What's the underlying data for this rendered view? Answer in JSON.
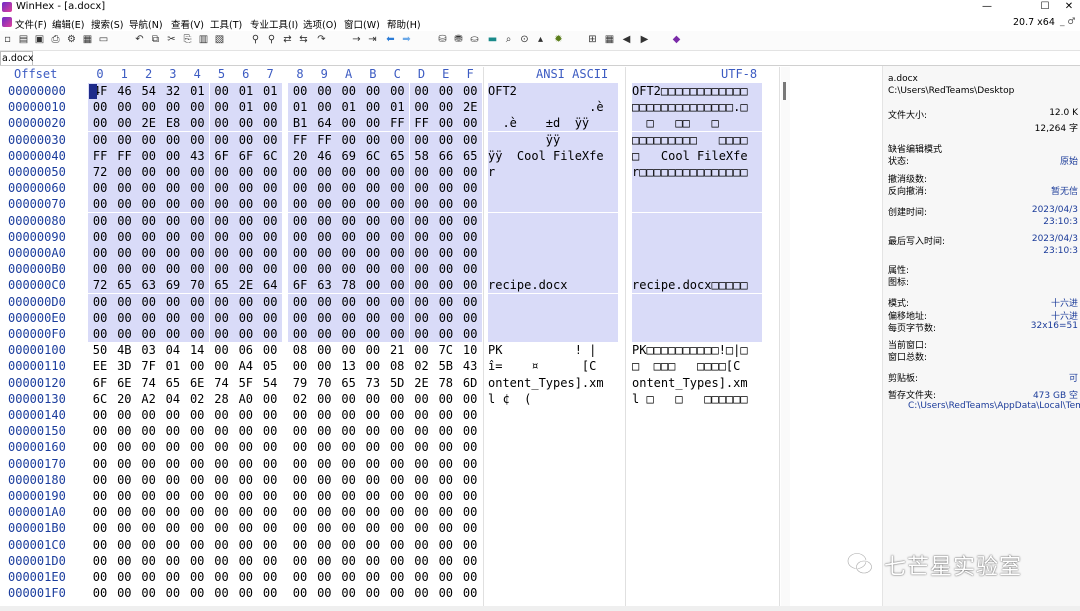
{
  "window": {
    "title": "WinHex - [a.docx]",
    "controls": [
      "—",
      "☐",
      "✕"
    ]
  },
  "menu": {
    "items": [
      "文件(F)",
      "编辑(E)",
      "搜索(S)",
      "导航(N)",
      "查看(V)",
      "工具(T)",
      "专业工具(I)",
      "选项(O)",
      "窗口(W)",
      "帮助(H)"
    ],
    "version": "20.7 x64",
    "extra": "_ ♂"
  },
  "tab": {
    "label": "a.docx"
  },
  "hex": {
    "headers": {
      "offset": "Offset",
      "columns": [
        "0",
        "1",
        "2",
        "3",
        "4",
        "5",
        "6",
        "7",
        "8",
        "9",
        "A",
        "B",
        "C",
        "D",
        "E",
        "F"
      ],
      "ansi": "ANSI ASCII",
      "utf8": "UTF-8"
    },
    "rows": [
      {
        "offset": "00000000",
        "bytes": "4F 46 54 32 01 00 01 01 00 00 00 00 00 00 00 00",
        "ansi": "OFT2",
        "utf8": "OFT2□□□□□□□□□□□□",
        "sel": true
      },
      {
        "offset": "00000010",
        "bytes": "00 00 00 00 00 00 01 00 01 00 01 00 01 00 00 2E E8",
        "ansi": "              .è",
        "utf8": "□□□□□□□□□□□□□□.□",
        "sel": true
      },
      {
        "offset": "00000020",
        "bytes": "00 00 2E E8 00 00 00 00 B1 64 00 00 FF FF 00 00",
        "ansi": "  .è    ±d  ÿÿ",
        "utf8": "  □   □□   □",
        "sel": true
      },
      {
        "offset": "00000030",
        "bytes": "00 00 00 00 00 00 00 00 FF FF 00 00 00 00 00 00",
        "ansi": "        ÿÿ",
        "utf8": "□□□□□□□□□   □□□□",
        "sel": true
      },
      {
        "offset": "00000040",
        "bytes": "FF FF 00 00 43 6F 6F 6C 20 46 69 6C 65 58 66 65",
        "ansi": "ÿÿ  Cool FileXfe",
        "utf8": "□   Cool FileXfe",
        "sel": true
      },
      {
        "offset": "00000050",
        "bytes": "72 00 00 00 00 00 00 00 00 00 00 00 00 00 00 00",
        "ansi": "r",
        "utf8": "r□□□□□□□□□□□□□□□",
        "sel": true
      },
      {
        "offset": "00000060",
        "bytes": "00 00 00 00 00 00 00 00 00 00 00 00 00 00 00 00",
        "ansi": "",
        "utf8": "",
        "sel": true
      },
      {
        "offset": "00000070",
        "bytes": "00 00 00 00 00 00 00 00 00 00 00 00 00 00 00 00",
        "ansi": "",
        "utf8": "",
        "sel": true
      },
      {
        "offset": "00000080",
        "bytes": "00 00 00 00 00 00 00 00 00 00 00 00 00 00 00 00",
        "ansi": "",
        "utf8": "",
        "sel": true
      },
      {
        "offset": "00000090",
        "bytes": "00 00 00 00 00 00 00 00 00 00 00 00 00 00 00 00",
        "ansi": "",
        "utf8": "",
        "sel": true
      },
      {
        "offset": "000000A0",
        "bytes": "00 00 00 00 00 00 00 00 00 00 00 00 00 00 00 00",
        "ansi": "",
        "utf8": "",
        "sel": true
      },
      {
        "offset": "000000B0",
        "bytes": "00 00 00 00 00 00 00 00 00 00 00 00 00 00 00 00",
        "ansi": "",
        "utf8": "",
        "sel": true
      },
      {
        "offset": "000000C0",
        "bytes": "72 65 63 69 70 65 2E 64 6F 63 78 00 00 00 00 00",
        "ansi": "recipe.docx",
        "utf8": "recipe.docx□□□□□",
        "sel": true
      },
      {
        "offset": "000000D0",
        "bytes": "00 00 00 00 00 00 00 00 00 00 00 00 00 00 00 00",
        "ansi": "",
        "utf8": "",
        "sel": true
      },
      {
        "offset": "000000E0",
        "bytes": "00 00 00 00 00 00 00 00 00 00 00 00 00 00 00 00",
        "ansi": "",
        "utf8": "",
        "sel": true
      },
      {
        "offset": "000000F0",
        "bytes": "00 00 00 00 00 00 00 00 00 00 00 00 00 00 00 00",
        "ansi": "",
        "utf8": "",
        "sel": true
      },
      {
        "offset": "00000100",
        "bytes": "50 4B 03 04 14 00 06 00 08 00 00 00 21 00 7C 10",
        "ansi": "PK          ! |",
        "utf8": "PK□□□□□□□□□□!□|□",
        "sel": false
      },
      {
        "offset": "00000110",
        "bytes": "EE 3D 7F 01 00 00 A4 05 00 00 13 00 08 02 5B 43",
        "ansi": "î=    ¤      [C",
        "utf8": "□  □□□   □□□□[C",
        "sel": false
      },
      {
        "offset": "00000120",
        "bytes": "6F 6E 74 65 6E 74 5F 54 79 70 65 73 5D 2E 78 6D",
        "ansi": "ontent_Types].xm",
        "utf8": "ontent_Types].xm",
        "sel": false
      },
      {
        "offset": "00000130",
        "bytes": "6C 20 A2 04 02 28 A0 00 02 00 00 00 00 00 00 00",
        "ansi": "l ¢  (",
        "utf8": "l □   □   □□□□□□",
        "sel": false
      },
      {
        "offset": "00000140",
        "bytes": "00 00 00 00 00 00 00 00 00 00 00 00 00 00 00 00",
        "ansi": "",
        "utf8": "",
        "sel": false
      },
      {
        "offset": "00000150",
        "bytes": "00 00 00 00 00 00 00 00 00 00 00 00 00 00 00 00",
        "ansi": "",
        "utf8": "",
        "sel": false
      },
      {
        "offset": "00000160",
        "bytes": "00 00 00 00 00 00 00 00 00 00 00 00 00 00 00 00",
        "ansi": "",
        "utf8": "",
        "sel": false
      },
      {
        "offset": "00000170",
        "bytes": "00 00 00 00 00 00 00 00 00 00 00 00 00 00 00 00",
        "ansi": "",
        "utf8": "",
        "sel": false
      },
      {
        "offset": "00000180",
        "bytes": "00 00 00 00 00 00 00 00 00 00 00 00 00 00 00 00",
        "ansi": "",
        "utf8": "",
        "sel": false
      },
      {
        "offset": "00000190",
        "bytes": "00 00 00 00 00 00 00 00 00 00 00 00 00 00 00 00",
        "ansi": "",
        "utf8": "",
        "sel": false
      },
      {
        "offset": "000001A0",
        "bytes": "00 00 00 00 00 00 00 00 00 00 00 00 00 00 00 00",
        "ansi": "",
        "utf8": "",
        "sel": false
      },
      {
        "offset": "000001B0",
        "bytes": "00 00 00 00 00 00 00 00 00 00 00 00 00 00 00 00",
        "ansi": "",
        "utf8": "",
        "sel": false
      },
      {
        "offset": "000001C0",
        "bytes": "00 00 00 00 00 00 00 00 00 00 00 00 00 00 00 00",
        "ansi": "",
        "utf8": "",
        "sel": false
      },
      {
        "offset": "000001D0",
        "bytes": "00 00 00 00 00 00 00 00 00 00 00 00 00 00 00 00",
        "ansi": "",
        "utf8": "",
        "sel": false
      },
      {
        "offset": "000001E0",
        "bytes": "00 00 00 00 00 00 00 00 00 00 00 00 00 00 00 00",
        "ansi": "",
        "utf8": "",
        "sel": false
      },
      {
        "offset": "000001F0",
        "bytes": "00 00 00 00 00 00 00 00 00 00 00 00 00 00 00 00",
        "ansi": "",
        "utf8": "",
        "sel": false
      }
    ]
  },
  "info": {
    "filename": "a.docx",
    "path": "C:\\Users\\RedTeams\\Desktop",
    "size_label": "文件大小:",
    "size_value1": "12.0 K",
    "size_value2": "12,264 字",
    "mode_label": "缺省编辑模式",
    "state_label": "状态:",
    "state_value": "原始",
    "undo_level_label": "撤消级数:",
    "undo_reverse_label": "反向撤消:",
    "undo_reverse_value": "暂无信",
    "created_label": "创建时间:",
    "created_date": "2023/04/3",
    "created_time": "23:10:3",
    "modified_label": "最后写入时间:",
    "modified_date": "2023/04/3",
    "modified_time": "23:10:3",
    "attr_label": "属性:",
    "icon_label": "图标:",
    "mode2_label": "模式:",
    "mode2_value": "十六进",
    "offset_label": "偏移地址:",
    "offset_value": "十六进",
    "bpp_label": "每页字节数:",
    "bpp_value": "32x16=51",
    "curwin_label": "当前窗口:",
    "wincount_label": "窗口总数:",
    "clipboard_label": "剪贴板:",
    "clipboard_value": "可",
    "temp_label": "暂存文件夹:",
    "temp_value": "473 GB 空",
    "temp_path": "C:\\Users\\RedTeams\\AppData\\Local\\Tem"
  },
  "watermark": {
    "text": "七芒星实验室"
  }
}
